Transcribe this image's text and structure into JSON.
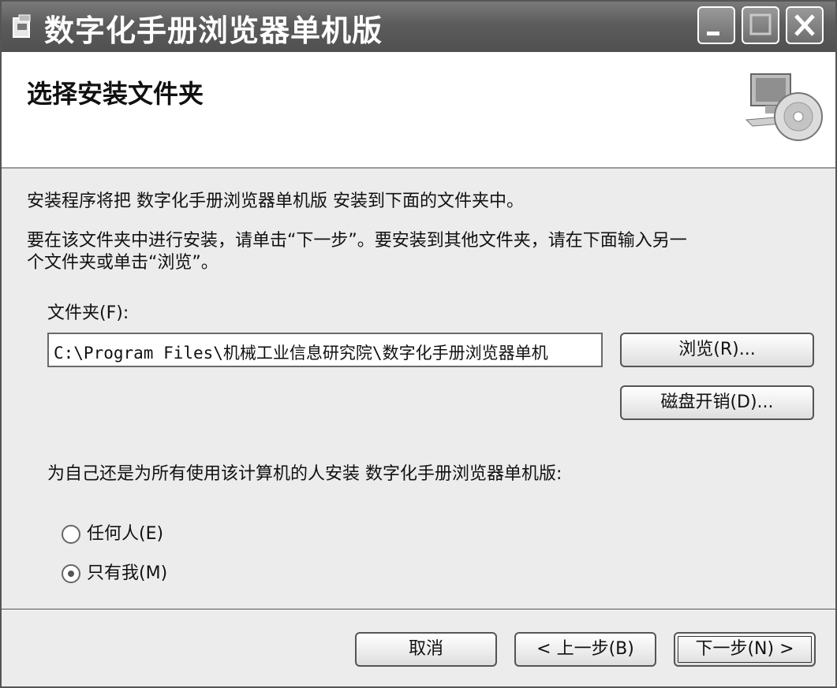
{
  "window": {
    "title": "数字化手册浏览器单机版"
  },
  "header": {
    "title": "选择安装文件夹"
  },
  "body": {
    "line1": "安装程序将把 数字化手册浏览器单机版 安装到下面的文件夹中。",
    "line2a": "要在该文件夹中进行安装，请单击“下一步”。要安装到其他文件夹，请在下面输入另一",
    "line2b": "个文件夹或单击“浏览”。",
    "folder_label": "文件夹(F):",
    "folder_value": "C:\\Program Files\\机械工业信息研究院\\数字化手册浏览器单机",
    "browse_label": "浏览(R)...",
    "disk_cost_label": "磁盘开销(D)...",
    "install_for_label": "为自己还是为所有使用该计算机的人安装 数字化手册浏览器单机版:",
    "radio_everyone_label": "任何人(E)",
    "radio_justme_label": "只有我(M)",
    "selected_option": "只有我(M)"
  },
  "footer": {
    "cancel_label": "取消",
    "back_label": "< 上一步(B)",
    "next_label": "下一步(N) >"
  },
  "icons": {
    "app": "installer-icon",
    "header": "computer-cd-icon",
    "minimize": "minimize-icon",
    "maximize": "maximize-icon",
    "close": "close-icon"
  }
}
